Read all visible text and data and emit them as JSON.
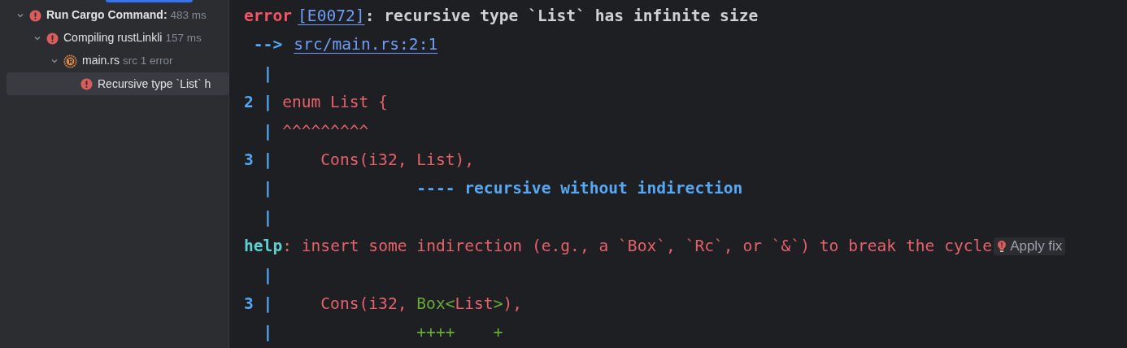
{
  "tree": [
    {
      "kind": "error",
      "title": "Run Cargo Command:",
      "emphasized": true,
      "detail": "483 ms",
      "expanded": true,
      "selected": false,
      "children": [
        {
          "kind": "error",
          "title": "Compiling rustLinkli",
          "emphasized": false,
          "detail": "157 ms",
          "expanded": true,
          "selected": false,
          "children": [
            {
              "kind": "rust",
              "title": "main.rs",
              "emphasized": false,
              "detail": "src 1 error",
              "expanded": true,
              "selected": false,
              "children": [
                {
                  "kind": "error",
                  "title": "Recursive type `List` h",
                  "emphasized": false,
                  "selected": true
                }
              ]
            }
          ]
        }
      ]
    }
  ],
  "output": [
    {
      "kind": "header",
      "segments": [
        {
          "kind": "error",
          "text": "error"
        },
        {
          "kind": "link",
          "text": "[E0072]"
        },
        {
          "kind": "message",
          "text": ": recursive type `List` has infinite size"
        }
      ]
    },
    {
      "kind": "header",
      "segments": [
        {
          "kind": "arrow",
          "text": " -->"
        },
        {
          "kind": "link",
          "text": "src/main.rs:2:1"
        }
      ]
    },
    {
      "kind": "source",
      "gutter": "|"
    },
    {
      "kind": "source",
      "number": "2",
      "gutter": "|",
      "segments": [
        {
          "kind": "code",
          "text": "enum List {"
        }
      ]
    },
    {
      "kind": "source",
      "gutter": "|",
      "segments": [
        {
          "kind": "marker",
          "text": "^^^^^^^^^"
        }
      ]
    },
    {
      "kind": "source",
      "number": "3",
      "gutter": "|",
      "segments": [
        {
          "kind": "code",
          "text": "    Cons(i32, List),"
        }
      ]
    },
    {
      "kind": "source",
      "gutter": "|",
      "segments": [
        {
          "kind": "note",
          "text": "              ---- recursive without indirection"
        }
      ]
    },
    {
      "kind": "source",
      "gutter": "|"
    },
    {
      "kind": "header",
      "segments": [
        {
          "kind": "help",
          "text": "help"
        },
        {
          "kind": "code",
          "text": ": insert some indirection (e.g., a `Box`, `Rc`, or `&`) to break the cycle"
        }
      ],
      "action": "Apply fix"
    },
    {
      "kind": "source",
      "gutter": "|"
    },
    {
      "kind": "source",
      "number": "3",
      "gutter": "|",
      "segments": [
        {
          "kind": "code",
          "text": "    Cons(i32, "
        },
        {
          "kind": "added",
          "text": "Box<"
        },
        {
          "kind": "code",
          "text": "List"
        },
        {
          "kind": "added",
          "text": ">"
        },
        {
          "kind": "code",
          "text": "),"
        }
      ]
    },
    {
      "kind": "source",
      "gutter": "|",
      "segments": [
        {
          "kind": "added",
          "text": "              ++++    +"
        }
      ]
    }
  ]
}
